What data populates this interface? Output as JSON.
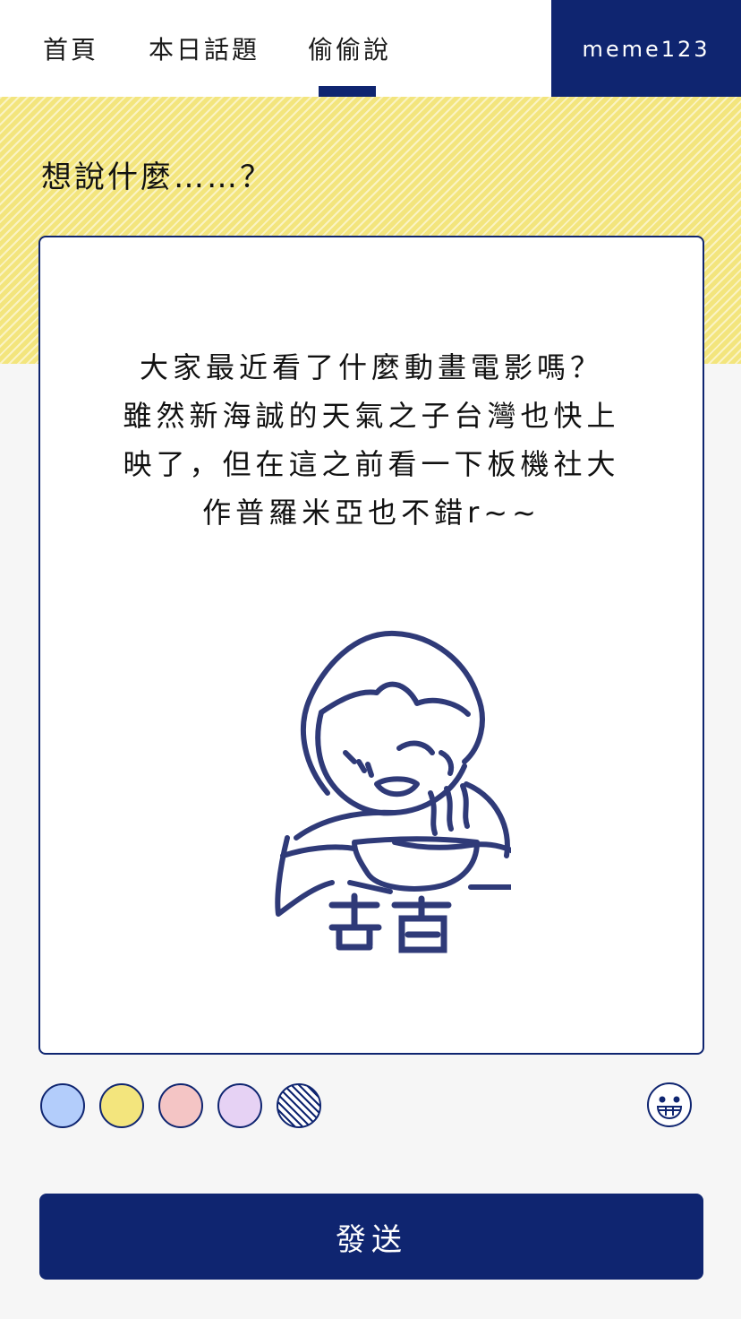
{
  "nav": {
    "tabs": [
      {
        "label": "首頁"
      },
      {
        "label": "本日話題"
      },
      {
        "label": "偷偷說"
      }
    ],
    "active_tab": 2,
    "username": "meme123"
  },
  "compose": {
    "prompt": "想說什麼……？",
    "body": "大家最近看了什麼動畫電影嗎？\n雖然新海誠的天氣之子台灣也快上\n映了，但在這之前看一下板機社大\n作普羅米亞也不錯r~~",
    "sticker": {
      "icon": "eating-noodles-doodle",
      "caption": "真香"
    }
  },
  "colors": {
    "accent": "#0f2570",
    "stripe_yellow": "#f3e57d",
    "swatches": [
      "#b3cdfb",
      "#f3e57d",
      "#f4c5c5",
      "#e6d2f4",
      "striped"
    ]
  },
  "actions": {
    "emoji_icon": "grin-face-icon",
    "send_label": "發送"
  }
}
